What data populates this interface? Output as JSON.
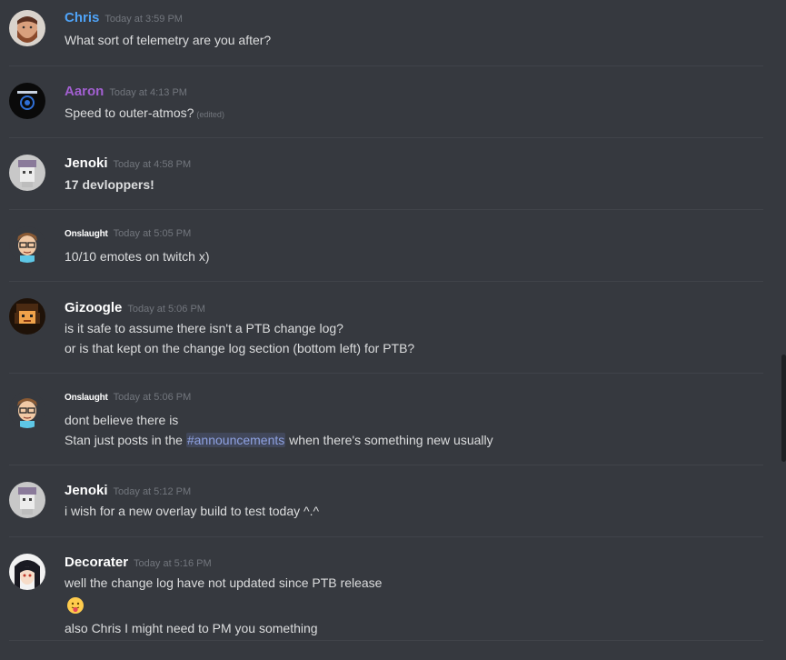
{
  "messages": [
    {
      "username": "Chris",
      "timestamp": "Today at 3:59 PM",
      "lines": [
        "What sort of telemetry are you after?"
      ],
      "avatar": "bearded-man-avatar"
    },
    {
      "username": "Aaron",
      "timestamp": "Today at 4:13 PM",
      "lines": [
        "Speed to outer-atmos?"
      ],
      "edited": "(edited)",
      "avatar": "colonel-logo-avatar"
    },
    {
      "username": "Jenoki",
      "timestamp": "Today at 4:58 PM",
      "lines": [
        "17 devloppers!"
      ],
      "avatar": "pixel-ghost-avatar"
    },
    {
      "username": "Onslaught",
      "timestamp": "Today at 5:05 PM",
      "lines": [
        "10/10 emotes on twitch x)"
      ],
      "avatar": "cartoon-glasses-avatar"
    },
    {
      "username": "Gizoogle",
      "timestamp": "Today at 5:06 PM",
      "lines": [
        "is it safe to assume there isn't a PTB change log?",
        "or is that kept on the change log section (bottom left) for PTB?"
      ],
      "avatar": "pixel-character-avatar"
    },
    {
      "username": "Onslaught",
      "timestamp": "Today at 5:06 PM",
      "lines": [
        "dont believe there is"
      ],
      "line2_before": "Stan just posts in the ",
      "mention": "#announcements",
      "line2_after": " when there's something new usually",
      "avatar": "cartoon-glasses-avatar"
    },
    {
      "username": "Jenoki",
      "timestamp": "Today at 5:12 PM",
      "lines": [
        "i wish for a new overlay build to test today ^.^"
      ],
      "avatar": "pixel-ghost-avatar"
    },
    {
      "username": "Decorater",
      "timestamp": "Today at 5:16 PM",
      "lines": [
        "well the change log have not updated since PTB release",
        "also Chris I might need to PM you something"
      ],
      "emoji": "tongue-out-emoji",
      "avatar": "anime-girl-avatar"
    }
  ],
  "colors": {
    "background": "#36393f",
    "chris_name": "#4fa3f7",
    "aaron_name": "#a25fd1",
    "mention": "#8ea1e1"
  }
}
